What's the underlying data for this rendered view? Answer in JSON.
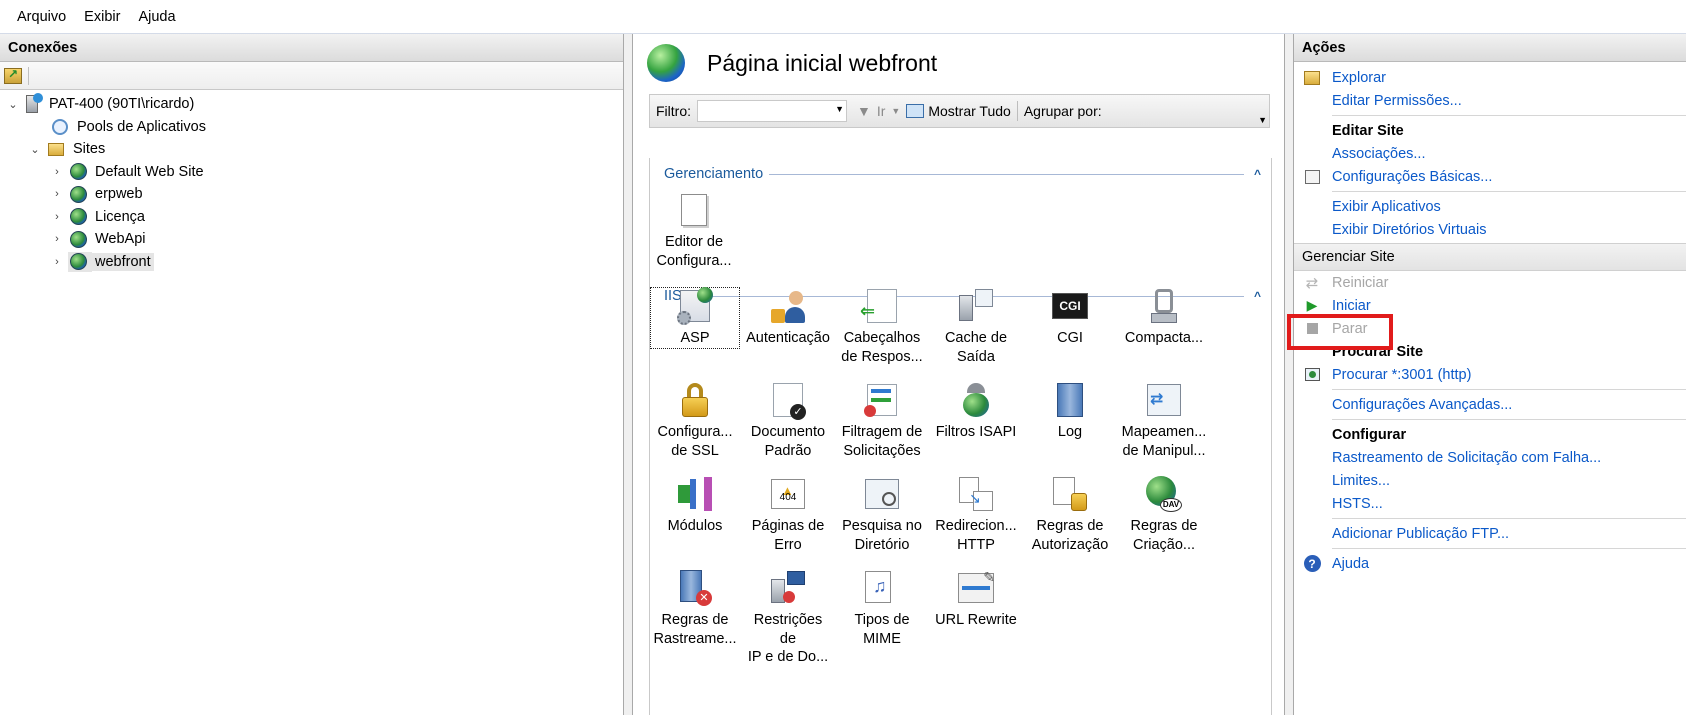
{
  "menu": [
    "Arquivo",
    "Exibir",
    "Ajuda"
  ],
  "left": {
    "title": "Conexões",
    "tree": {
      "server": "PAT-400 (90TI\\ricardo)",
      "app_pools": "Pools de Aplicativos",
      "sites": "Sites",
      "site_items": [
        "Default Web Site",
        "erpweb",
        "Licença",
        "WebApi",
        "webfront"
      ]
    }
  },
  "center": {
    "title": "Página inicial webfront",
    "filter": {
      "label": "Filtro:",
      "go": "Ir",
      "show_all": "Mostrar Tudo",
      "group_by": "Agrupar por:"
    },
    "groups": {
      "management": "Gerenciamento",
      "iis": "IIS"
    },
    "management_items": [
      [
        "Editor de",
        "Configura..."
      ]
    ],
    "iis_items": [
      [
        "ASP",
        ""
      ],
      [
        "Autenticação",
        ""
      ],
      [
        "Cabeçalhos",
        "de Respos..."
      ],
      [
        "Cache de",
        "Saída"
      ],
      [
        "CGI",
        ""
      ],
      [
        "Compacta...",
        ""
      ],
      [
        "Configura...",
        "de SSL"
      ],
      [
        "Documento",
        "Padrão"
      ],
      [
        "Filtragem de",
        "Solicitações"
      ],
      [
        "Filtros ISAPI",
        ""
      ],
      [
        "Log",
        ""
      ],
      [
        "Mapeamen...",
        "de Manipul..."
      ],
      [
        "Módulos",
        ""
      ],
      [
        "Páginas de",
        "Erro"
      ],
      [
        "Pesquisa no",
        "Diretório"
      ],
      [
        "Redirecion...",
        "HTTP"
      ],
      [
        "Regras de",
        "Autorização"
      ],
      [
        "Regras de",
        "Criação..."
      ],
      [
        "Regras de",
        "Rastreame..."
      ],
      [
        "Restrições de",
        "IP e de Do..."
      ],
      [
        "Tipos de",
        "MIME"
      ],
      [
        "URL Rewrite",
        ""
      ]
    ],
    "cgi_icon_text": "CGI",
    "error_icon_text": "404",
    "dav_icon_text": "DAV"
  },
  "right": {
    "title": "Ações",
    "explore": "Explorar",
    "edit_perms": "Editar Permissões...",
    "edit_site": "Editar Site",
    "bindings": "Associações...",
    "basic_settings": "Configurações Básicas...",
    "view_apps": "Exibir Aplicativos",
    "view_vdirs": "Exibir Diretórios Virtuais",
    "manage_site": "Gerenciar Site",
    "restart": "Reiniciar",
    "start": "Iniciar",
    "stop": "Parar",
    "browse_site": "Procurar Site",
    "browse_link": "Procurar *:3001 (http)",
    "advanced": "Configurações Avançadas...",
    "configure": "Configurar",
    "failed_tracing": "Rastreamento de Solicitação com Falha...",
    "limits": "Limites...",
    "hsts": "HSTS...",
    "ftp": "Adicionar Publicação FTP...",
    "help": "Ajuda"
  }
}
